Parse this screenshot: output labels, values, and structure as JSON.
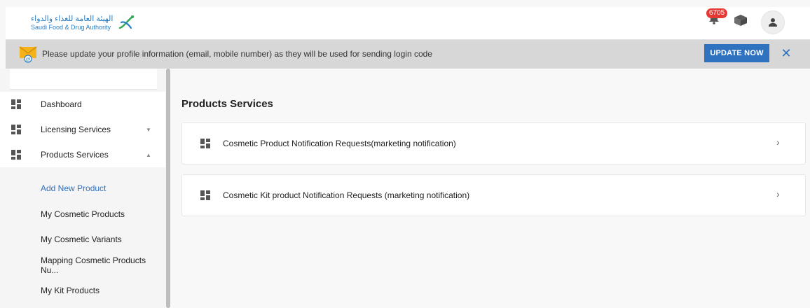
{
  "header": {
    "logo_arabic": "الهيئة العامة للغذاء والدواء",
    "logo_english": "Saudi Food & Drug Authority",
    "notification_count": "6705",
    "icons": [
      "bell-icon",
      "box-icon",
      "user-icon"
    ]
  },
  "banner": {
    "message": "Please update your profile information (email, mobile number) as they will be used for sending login code",
    "update_label": "UPDATE NOW",
    "close_label": "✕",
    "icon": "mail-icon"
  },
  "sidebar": {
    "items": [
      {
        "label": "Dashboard",
        "icon": "dashboard-icon",
        "caret": ""
      },
      {
        "label": "Licensing Services",
        "icon": "dashboard-icon",
        "caret": "▼"
      },
      {
        "label": "Products Services",
        "icon": "dashboard-icon",
        "caret": "▲"
      }
    ],
    "subitems": [
      {
        "label": "Add New Product",
        "active": true
      },
      {
        "label": "My Cosmetic Products",
        "active": false
      },
      {
        "label": "My Cosmetic Variants",
        "active": false
      },
      {
        "label": "Mapping Cosmetic Products Nu...",
        "active": false
      },
      {
        "label": "My Kit Products",
        "active": false
      }
    ]
  },
  "main": {
    "title": "Products Services",
    "cards": [
      {
        "label": "Cosmetic Product Notification Requests(marketing notification)",
        "chevron": "›"
      },
      {
        "label": "Cosmetic Kit product Notification Requests (marketing notification)",
        "chevron": "›"
      }
    ]
  },
  "colors": {
    "accent": "#2e72c0",
    "badge": "#e53935",
    "banner_bg": "#d7d7d7"
  }
}
